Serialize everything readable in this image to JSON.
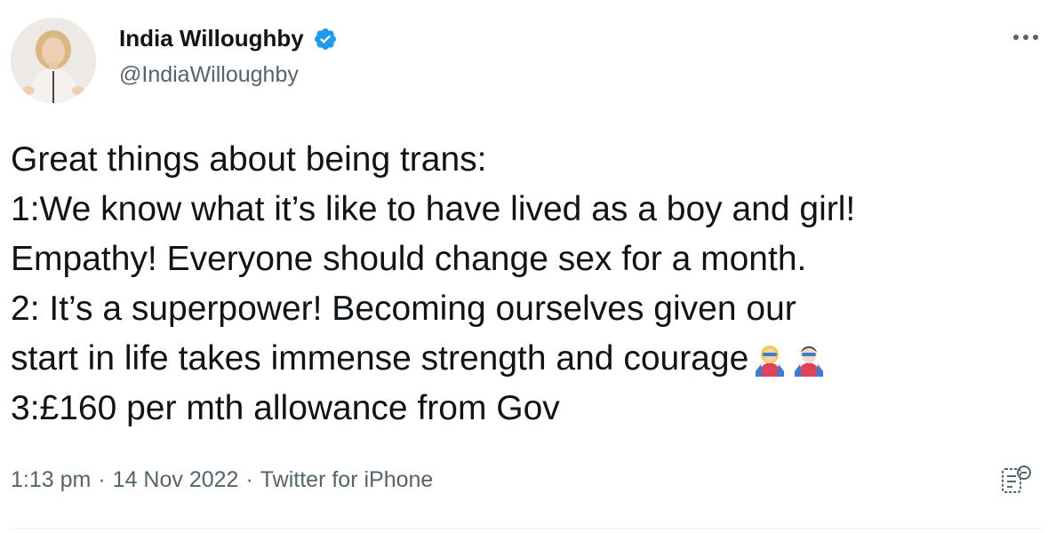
{
  "author": {
    "display_name": "India Willoughby",
    "handle": "@IndiaWilloughby",
    "verified": true
  },
  "tweet": {
    "lines": [
      "Great things about being trans:",
      "1:We know what it’s like to have lived as a boy and girl!",
      "Empathy! Everyone should change sex for a month.",
      "2: It’s a superpower! Becoming ourselves given our",
      "start in life takes immense strength and courage",
      "3:£160 per mth allowance from Gov"
    ],
    "emojis": [
      "woman-superhero-emoji",
      "man-superhero-emoji"
    ]
  },
  "meta": {
    "time": "1:13 pm",
    "separator": "·",
    "date": "14 Nov 2022",
    "source": "Twitter for iPhone"
  },
  "colors": {
    "text": "#0f1419",
    "secondary": "#536471",
    "verified": "#1d9bf0"
  },
  "icons": {
    "more": "more-dots-icon",
    "analytics": "tweet-analytics-icon",
    "verified": "verified-badge-icon"
  }
}
